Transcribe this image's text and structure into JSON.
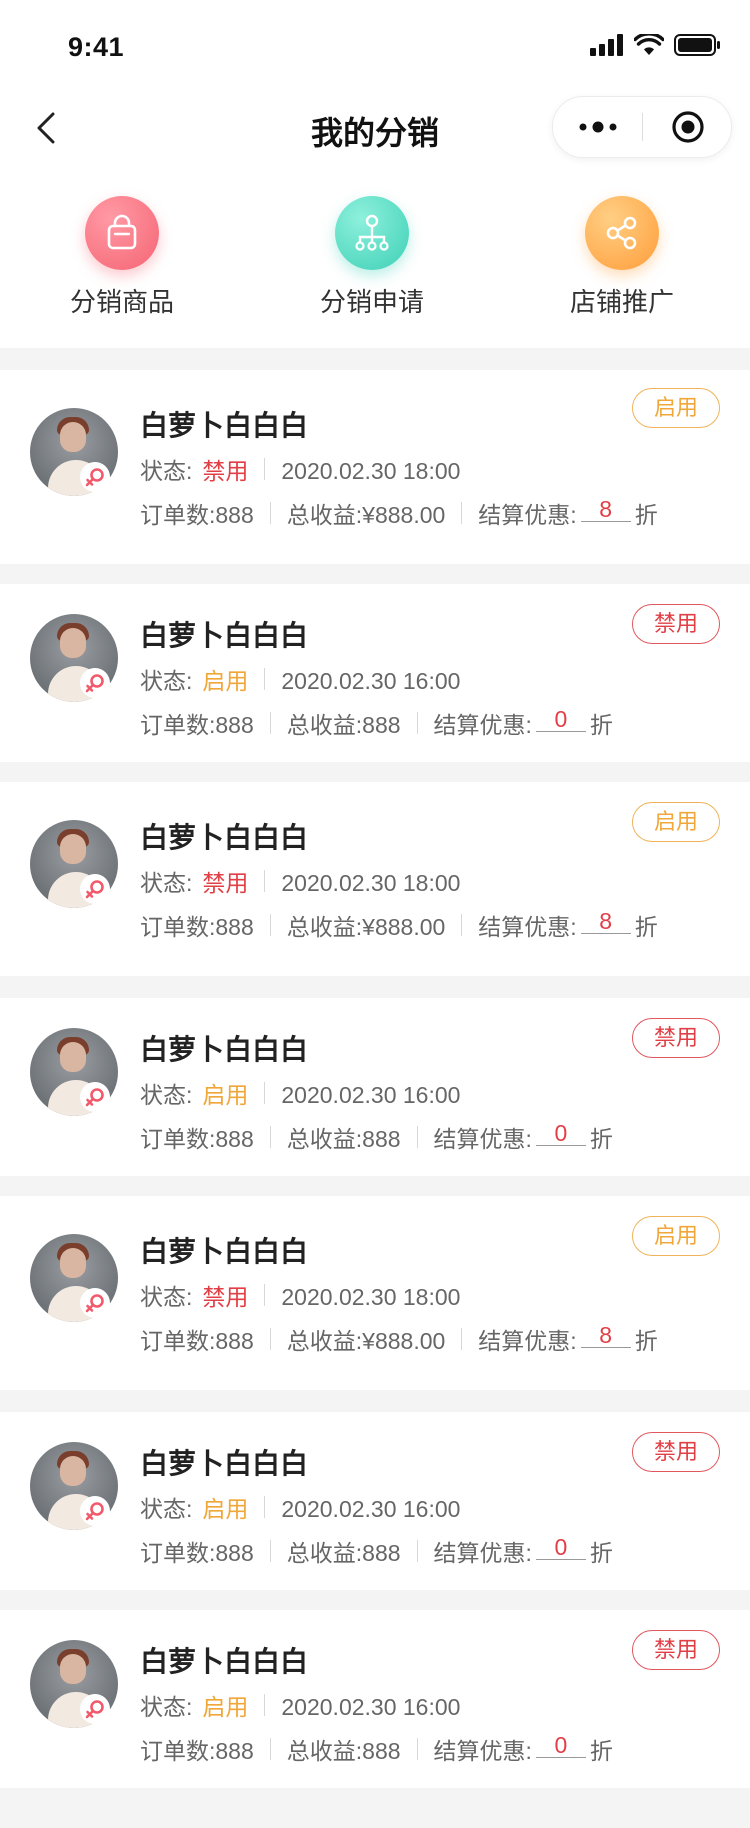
{
  "status_bar": {
    "time": "9:41"
  },
  "nav": {
    "title": "我的分销"
  },
  "quick_entries": [
    {
      "label": "分销商品",
      "icon": "shopping-bag-icon"
    },
    {
      "label": "分销申请",
      "icon": "hierarchy-icon"
    },
    {
      "label": "店铺推广",
      "icon": "share-icon"
    }
  ],
  "labels": {
    "status": "状态:",
    "orders": "订单数:888",
    "settlement": "结算优惠:",
    "discount_unit": "折"
  },
  "colors": {
    "disabled_red": "#e13f46",
    "enabled_orange": "#f0a73a",
    "pink_icon": "#f56473",
    "teal_icon": "#3ed0b6",
    "orange_icon": "#ff9d3a"
  },
  "distributors": [
    {
      "name": "白萝卜白白白",
      "status": "禁用",
      "datetime": "2020.02.30 18:00",
      "revenue": "总收益:¥888.00",
      "discount": "8",
      "action": "启用"
    },
    {
      "name": "白萝卜白白白",
      "status": "启用",
      "datetime": "2020.02.30 16:00",
      "revenue": "总收益:888",
      "discount": "0",
      "action": "禁用"
    },
    {
      "name": "白萝卜白白白",
      "status": "禁用",
      "datetime": "2020.02.30 18:00",
      "revenue": "总收益:¥888.00",
      "discount": "8",
      "action": "启用"
    },
    {
      "name": "白萝卜白白白",
      "status": "启用",
      "datetime": "2020.02.30 16:00",
      "revenue": "总收益:888",
      "discount": "0",
      "action": "禁用"
    },
    {
      "name": "白萝卜白白白",
      "status": "禁用",
      "datetime": "2020.02.30 18:00",
      "revenue": "总收益:¥888.00",
      "discount": "8",
      "action": "启用"
    },
    {
      "name": "白萝卜白白白",
      "status": "启用",
      "datetime": "2020.02.30 16:00",
      "revenue": "总收益:888",
      "discount": "0",
      "action": "禁用"
    },
    {
      "name": "白萝卜白白白",
      "status": "启用",
      "datetime": "2020.02.30 16:00",
      "revenue": "总收益:888",
      "discount": "0",
      "action": "禁用"
    }
  ]
}
